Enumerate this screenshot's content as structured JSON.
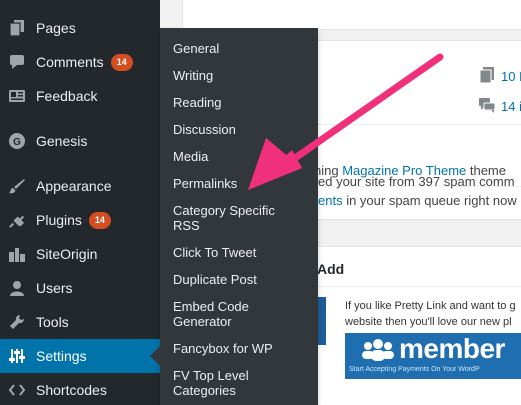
{
  "menu": {
    "pages": "Pages",
    "comments": "Comments",
    "comments_badge": "14",
    "feedback": "Feedback",
    "genesis": "Genesis",
    "appearance": "Appearance",
    "plugins": "Plugins",
    "plugins_badge": "14",
    "siteorigin": "SiteOrigin",
    "users": "Users",
    "tools": "Tools",
    "settings": "Settings",
    "shortcodes": "Shortcodes"
  },
  "submenu": {
    "general": "General",
    "writing": "Writing",
    "reading": "Reading",
    "discussion": "Discussion",
    "media": "Media",
    "permalinks": "Permalinks",
    "category_rss_1": "Category Specific",
    "category_rss_2": "RSS",
    "click_to_tweet": "Click To Tweet",
    "duplicate_post": "Duplicate Post",
    "embed_code_1": "Embed Code",
    "embed_code_2": "Generator",
    "fancybox": "Fancybox for WP",
    "fv_top_1": "FV Top Level",
    "fv_top_2": "Categories"
  },
  "content": {
    "count_pages": "10 P",
    "count_comments": "14 i",
    "theme_prefix": "ning ",
    "theme_link": "Magazine Pro Theme",
    "theme_suffix": " theme",
    "spam_line1": "ed your site from 397 spam comm",
    "spam_link": "ents",
    "spam_line2": " in your spam queue right now",
    "add_heading": "Add",
    "promo_text_1": "If you like Pretty Link and want to g",
    "promo_text_2": "website then you'll love our new pl",
    "banner_brand": "member",
    "banner_tagline": "Start Accepting Payments On Your WordP"
  },
  "colors": {
    "menu_bg": "#23282d",
    "submenu_bg": "#32373c",
    "active": "#0073aa",
    "badge": "#d54e21",
    "arrow": "#f0307a",
    "link": "#0073aa"
  }
}
